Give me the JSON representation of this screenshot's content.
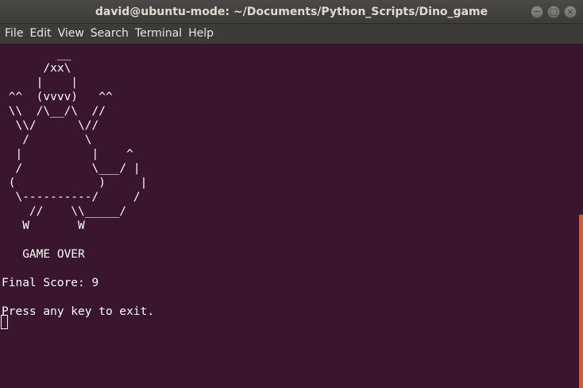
{
  "window": {
    "title": "david@ubuntu-mode: ~/Documents/Python_Scripts/Dino_game",
    "buttons": {
      "minimize": "−",
      "maximize": "□",
      "close": "×"
    }
  },
  "menu": {
    "file": "File",
    "edit": "Edit",
    "view": "View",
    "search": "Search",
    "terminal": "Terminal",
    "help": "Help"
  },
  "terminal": {
    "output": "        __\n      /xx\\\n     |    |\n ^^  (vvvv)   ^^\n \\\\  /\\__/\\  //\n  \\\\/      \\//\n   /        \\\n  |          |    ^\n  /          \\___/ |\n (            )     |\n  \\----------/     /\n    //    \\\\_____/\n   W       W\n\n   GAME OVER\n\nFinal Score: 9\n\nPress any key to exit."
  },
  "colors": {
    "terminal_bg": "#3a1530",
    "titlebar_bg": "#3c3b37",
    "scrollbar": "#e9541f",
    "text": "#ffffff"
  }
}
